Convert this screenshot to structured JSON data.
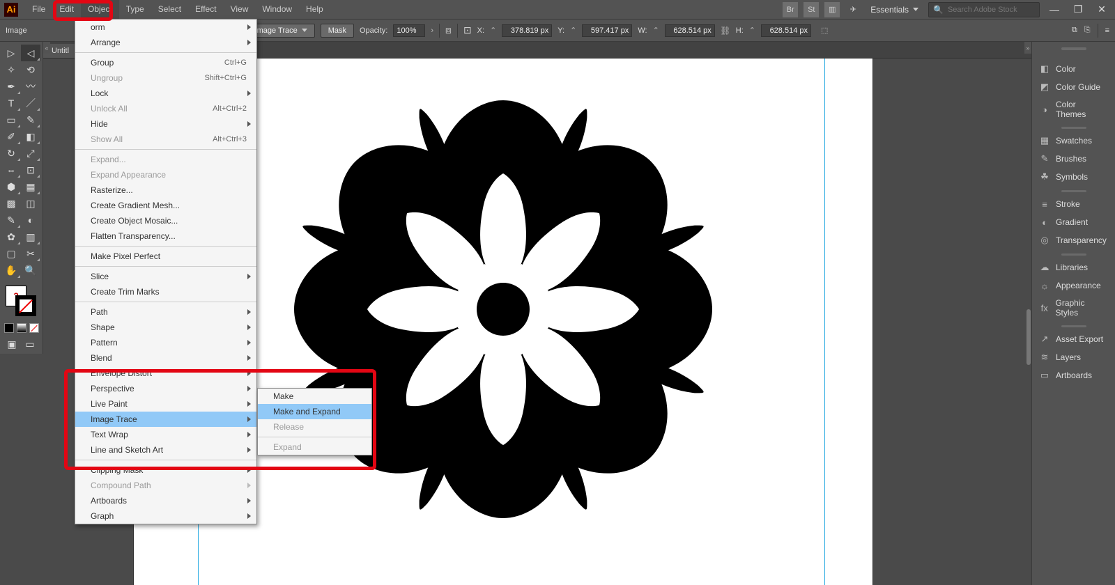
{
  "app_logo": "Ai",
  "menubar": [
    "File",
    "Edit",
    "Object",
    "Type",
    "Select",
    "Effect",
    "View",
    "Window",
    "Help"
  ],
  "active_menu_index": 2,
  "workspace": "Essentials",
  "search_placeholder": "Search Adobe Stock",
  "optbar": {
    "label": "Image",
    "image_trace_btn": "Image Trace",
    "mask_btn": "Mask",
    "opacity_label": "Opacity:",
    "opacity_val": "100%",
    "x_label": "X:",
    "x_val": "378.819 px",
    "y_label": "Y:",
    "y_val": "597.417 px",
    "w_label": "W:",
    "w_val": "628.514 px",
    "h_label": "H:",
    "h_val": "628.514 px"
  },
  "doc_tab": "Untitl",
  "object_menu": [
    {
      "label": "Transform",
      "sub": true,
      "partly_cut": "orm"
    },
    {
      "label": "Arrange",
      "sub": true
    },
    "---",
    {
      "label": "Group",
      "sc": "Ctrl+G"
    },
    {
      "label": "Ungroup",
      "sc": "Shift+Ctrl+G",
      "disabled": true
    },
    {
      "label": "Lock",
      "sub": true
    },
    {
      "label": "Unlock All",
      "sc": "Alt+Ctrl+2",
      "disabled": true
    },
    {
      "label": "Hide",
      "sub": true
    },
    {
      "label": "Show All",
      "sc": "Alt+Ctrl+3",
      "disabled": true
    },
    "---",
    {
      "label": "Expand...",
      "disabled": true
    },
    {
      "label": "Expand Appearance",
      "disabled": true
    },
    {
      "label": "Rasterize..."
    },
    {
      "label": "Create Gradient Mesh..."
    },
    {
      "label": "Create Object Mosaic..."
    },
    {
      "label": "Flatten Transparency..."
    },
    "---",
    {
      "label": "Make Pixel Perfect"
    },
    "---",
    {
      "label": "Slice",
      "sub": true
    },
    {
      "label": "Create Trim Marks"
    },
    "---",
    {
      "label": "Path",
      "sub": true
    },
    {
      "label": "Shape",
      "sub": true
    },
    {
      "label": "Pattern",
      "sub": true
    },
    {
      "label": "Blend",
      "sub": true
    },
    {
      "label": "Envelope Distort",
      "sub": true
    },
    {
      "label": "Perspective",
      "sub": true
    },
    {
      "label": "Live Paint",
      "sub": true
    },
    {
      "label": "Image Trace",
      "sub": true,
      "hov": true
    },
    {
      "label": "Text Wrap",
      "sub": true
    },
    {
      "label": "Line and Sketch Art",
      "sub": true
    },
    "---",
    {
      "label": "Clipping Mask",
      "sub": true
    },
    {
      "label": "Compound Path",
      "sub": true,
      "disabled": true
    },
    {
      "label": "Artboards",
      "sub": true
    },
    {
      "label": "Graph",
      "sub": true
    }
  ],
  "image_trace_submenu": [
    {
      "label": "Make"
    },
    {
      "label": "Make and Expand",
      "hov": true
    },
    {
      "label": "Release",
      "disabled": true
    },
    "---",
    {
      "label": "Expand",
      "disabled": true
    }
  ],
  "panels": [
    {
      "icon": "◧",
      "label": "Color"
    },
    {
      "icon": "◩",
      "label": "Color Guide"
    },
    {
      "icon": "◑",
      "label": "Color Themes"
    },
    "sep",
    {
      "icon": "▦",
      "label": "Swatches"
    },
    {
      "icon": "✎",
      "label": "Brushes"
    },
    {
      "icon": "☘",
      "label": "Symbols"
    },
    "sep",
    {
      "icon": "≡",
      "label": "Stroke"
    },
    {
      "icon": "◐",
      "label": "Gradient"
    },
    {
      "icon": "◎",
      "label": "Transparency"
    },
    "sep",
    {
      "icon": "☁",
      "label": "Libraries"
    },
    {
      "icon": "☼",
      "label": "Appearance"
    },
    {
      "icon": "fx",
      "label": "Graphic Styles"
    },
    "sep",
    {
      "icon": "↗",
      "label": "Asset Export"
    },
    {
      "icon": "≋",
      "label": "Layers"
    },
    {
      "icon": "▭",
      "label": "Artboards"
    }
  ]
}
